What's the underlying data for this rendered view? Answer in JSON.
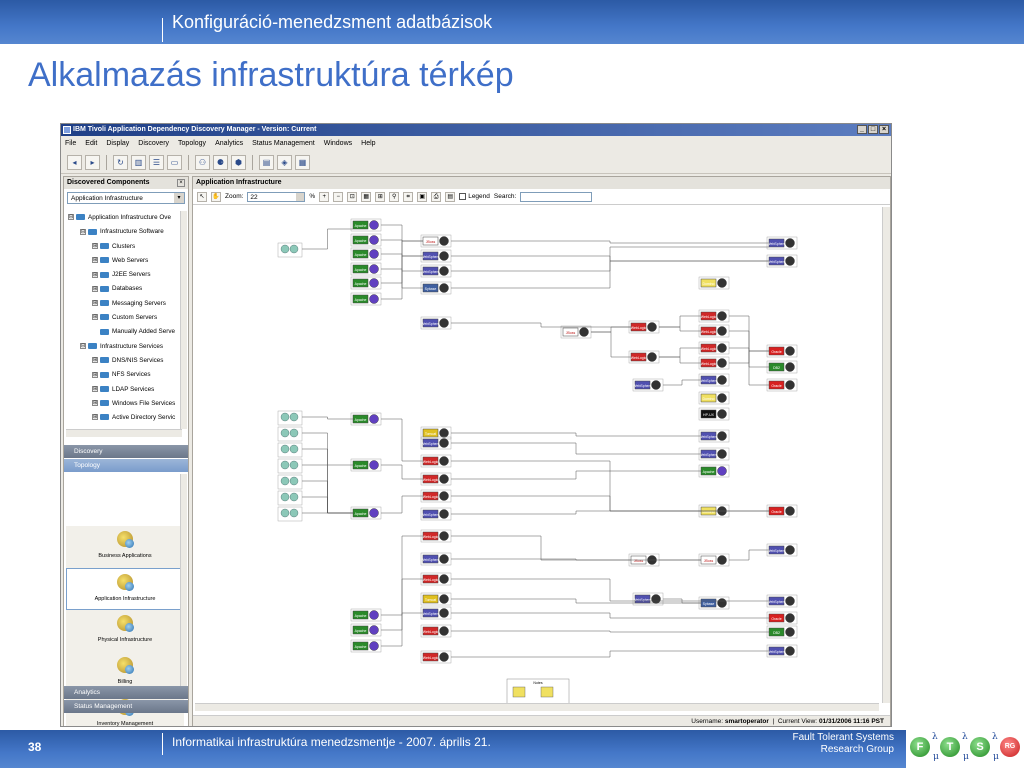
{
  "slide": {
    "header": "Konfiguráció-menedzsment adatbázisok",
    "title": "Alkalmazás infrastruktúra térkép",
    "number": "38",
    "footer": "Informatikai infrastruktúra menedzsmentje - 2007. április 21.",
    "org_line1": "Fault Tolerant Systems",
    "org_line2": "Research Group"
  },
  "logo": {
    "letters": [
      "F",
      "T",
      "S",
      "RG"
    ],
    "glyphs": [
      "λ",
      "μ",
      "λ",
      "μ",
      "λ",
      "μ"
    ]
  },
  "window": {
    "title": "IBM Tivoli Application Dependency Discovery Manager - Version: Current",
    "buttons": [
      "_",
      "□",
      "×"
    ]
  },
  "menu": [
    "File",
    "Edit",
    "Display",
    "Discovery",
    "Topology",
    "Analytics",
    "Status Management",
    "Windows",
    "Help"
  ],
  "left_panel": {
    "header": "Discovered Components",
    "combo_value": "Application Infrastructure",
    "tree": [
      {
        "label": "Application Infrastructure Ove",
        "depth": 0,
        "exp": "⊟"
      },
      {
        "label": "Infrastructure Software",
        "depth": 1,
        "exp": "⊟"
      },
      {
        "label": "Clusters",
        "depth": 2,
        "exp": "⊞"
      },
      {
        "label": "Web Servers",
        "depth": 2,
        "exp": "⊞"
      },
      {
        "label": "J2EE Servers",
        "depth": 2,
        "exp": "⊞"
      },
      {
        "label": "Databases",
        "depth": 2,
        "exp": "⊞"
      },
      {
        "label": "Messaging Servers",
        "depth": 2,
        "exp": "⊞"
      },
      {
        "label": "Custom Servers",
        "depth": 2,
        "exp": "⊞"
      },
      {
        "label": "Manually Added Serve",
        "depth": 2,
        "exp": ""
      },
      {
        "label": "Infrastructure Services",
        "depth": 1,
        "exp": "⊟"
      },
      {
        "label": "DNS/NIS Services",
        "depth": 2,
        "exp": "⊞"
      },
      {
        "label": "NFS Services",
        "depth": 2,
        "exp": "⊞"
      },
      {
        "label": "LDAP Services",
        "depth": 2,
        "exp": "⊞"
      },
      {
        "label": "Windows File Services",
        "depth": 2,
        "exp": "⊞"
      },
      {
        "label": "Active Directory Servic",
        "depth": 2,
        "exp": "⊞"
      }
    ],
    "accordion_top": [
      "Discovery",
      "Topology"
    ],
    "topology_items": [
      "Business Applications",
      "Application Infrastructure",
      "Physical Infrastructure",
      "Billing",
      "Inventory Management"
    ],
    "accordion_bottom": [
      "Analytics",
      "Status Management"
    ]
  },
  "right_panel": {
    "header": "Application Infrastructure",
    "zoom_label": "Zoom:",
    "zoom_value": "22",
    "zoom_unit": "%",
    "legend_label": "Legend",
    "search_label": "Search:"
  },
  "status": {
    "user_label": "Username:",
    "user": "smartoperator",
    "view_label": "Current View:",
    "view": "01/31/2006 11:16 PST"
  },
  "colors": {
    "slide_blue": "#3f6fc8",
    "bar_blue": "#4477c8",
    "titlebar": "#1f3f86",
    "apache": "#2a8a2a",
    "websphere": "#5050b0",
    "weblogic": "#d02828",
    "db_red": "#d82020",
    "db2_green": "#2a8a2a",
    "jboss": "#e08080"
  },
  "diagram_nodes": {
    "apache": "Apache",
    "jboss": "JBoss",
    "websphere": "WebSphere",
    "weblogic": "WebLogic",
    "oracle": "Oracle",
    "db2": "DB2",
    "tomcat": "Tomcat",
    "domino": "Domino",
    "sybase": "Sybase",
    "hpux": "HP-UX",
    "notes": "Notes"
  }
}
